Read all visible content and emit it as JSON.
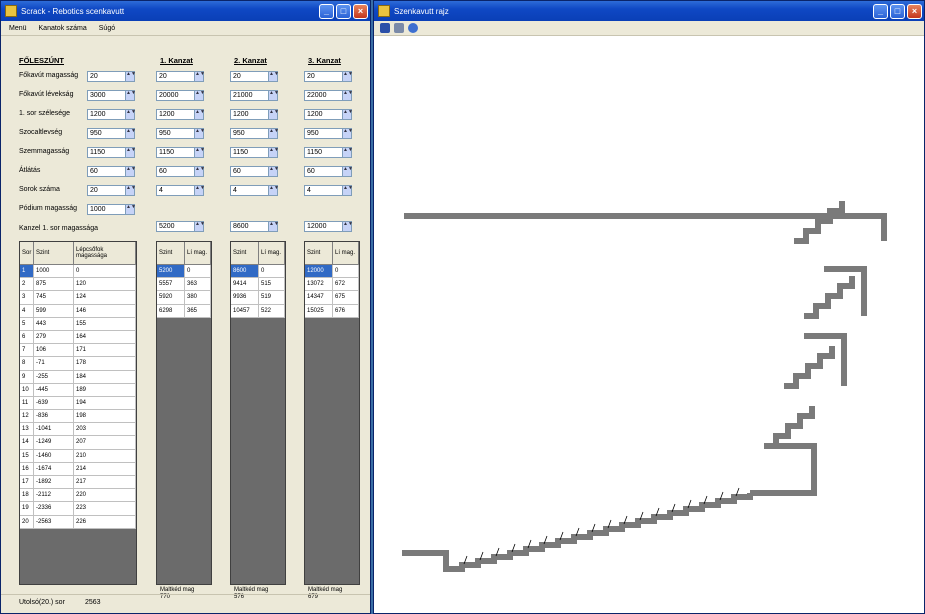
{
  "left_window": {
    "title": "Scrack - Rebotics scenkavutt",
    "menu": [
      "Menü",
      "Kanatok száma",
      "Súgó"
    ]
  },
  "params": {
    "header": "FŐLESZÚNT",
    "rows": [
      {
        "label": "Főkavút magasság",
        "value": "20"
      },
      {
        "label": "Főkavút lévekság",
        "value": "3000"
      },
      {
        "label": "1. sor szélesége",
        "value": "1200"
      },
      {
        "label": "Szocaltlevség",
        "value": "950"
      },
      {
        "label": "Szemmagasság",
        "value": "1150"
      },
      {
        "label": "Átlátás",
        "value": "60"
      },
      {
        "label": "Sorok száma",
        "value": "20"
      },
      {
        "label": "Pódium magasság",
        "value": "1000"
      }
    ],
    "kanzel_label": "Kanzel 1. sor magassága"
  },
  "sections": [
    {
      "header": "1. Kanzat",
      "values": [
        "20",
        "20000",
        "1200",
        "950",
        "1150",
        "60",
        "4"
      ],
      "kanzel": "5200",
      "grid": [
        [
          "5200",
          "0"
        ],
        [
          "5557",
          "363"
        ],
        [
          "5920",
          "380"
        ],
        [
          "6298",
          "365"
        ]
      ],
      "footer": "Maltkéd mag\n770"
    },
    {
      "header": "2. Kanzat",
      "values": [
        "20",
        "21000",
        "1200",
        "950",
        "1150",
        "60",
        "4"
      ],
      "kanzel": "8600",
      "grid": [
        [
          "8600",
          "0"
        ],
        [
          "9414",
          "515"
        ],
        [
          "9936",
          "519"
        ],
        [
          "10457",
          "522"
        ]
      ],
      "footer": "Maltkéd mag\n576"
    },
    {
      "header": "3. Kanzat",
      "values": [
        "20",
        "22000",
        "1200",
        "950",
        "1150",
        "60",
        "4"
      ],
      "kanzel": "12000",
      "grid": [
        [
          "12000",
          "0"
        ],
        [
          "13072",
          "672"
        ],
        [
          "14347",
          "675"
        ],
        [
          "15025",
          "676"
        ]
      ],
      "footer": "Maltkéd mag\n679"
    }
  ],
  "main_grid": {
    "headers": [
      "Sor",
      "Szint",
      "Lépcsőfok magassága"
    ],
    "rows": [
      [
        "1",
        "1000",
        "0"
      ],
      [
        "2",
        "875",
        "120"
      ],
      [
        "3",
        "745",
        "124"
      ],
      [
        "4",
        "599",
        "146"
      ],
      [
        "5",
        "443",
        "155"
      ],
      [
        "6",
        "279",
        "164"
      ],
      [
        "7",
        "106",
        "171"
      ],
      [
        "8",
        "-71",
        "178"
      ],
      [
        "9",
        "-255",
        "184"
      ],
      [
        "10",
        "-445",
        "189"
      ],
      [
        "11",
        "-639",
        "194"
      ],
      [
        "12",
        "-836",
        "198"
      ],
      [
        "13",
        "-1041",
        "203"
      ],
      [
        "14",
        "-1249",
        "207"
      ],
      [
        "15",
        "-1460",
        "210"
      ],
      [
        "16",
        "-1674",
        "214"
      ],
      [
        "17",
        "-1892",
        "217"
      ],
      [
        "18",
        "-2112",
        "220"
      ],
      [
        "19",
        "-2336",
        "223"
      ],
      [
        "20",
        "-2563",
        "226"
      ]
    ]
  },
  "sub_grid_headers": [
    "Szint",
    "Lí mag."
  ],
  "status": {
    "label": "Utolsó(20.) sor",
    "value": "2563"
  },
  "right_window": {
    "title": "Szenkavutt rajz"
  },
  "colors": {
    "titlebar": "#0f48c4",
    "selection": "#316ac5",
    "profile": "#7a7a7a"
  },
  "icons": [
    "save-icon",
    "print-icon",
    "settings-icon"
  ]
}
